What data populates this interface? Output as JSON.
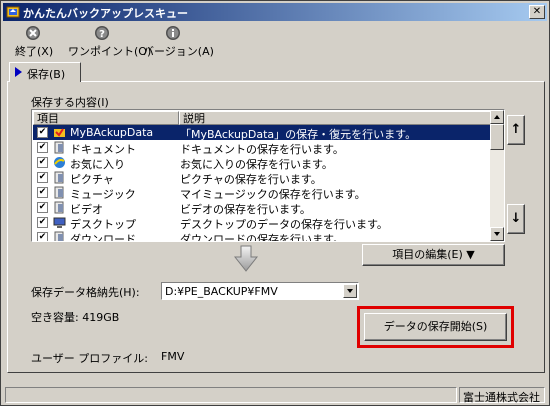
{
  "window": {
    "title": "かんたんバックアップレスキュー",
    "close_glyph": "✕"
  },
  "toolbar": {
    "exit_label": "終了(X)",
    "onepoint_label": "ワンポイント(O)",
    "version_label": "バージョン(A)"
  },
  "tabs": [
    {
      "label": "保存(B)"
    }
  ],
  "backup_list": {
    "label": "保存する内容(I)",
    "columns": [
      "項目",
      "説明"
    ],
    "rows": [
      {
        "name": "MyBAckupData",
        "desc": "「MyBAckupData」の保存・復元を行います。",
        "checked": "✔",
        "icon": "mybackup-icon",
        "selected": true
      },
      {
        "name": "ドキュメント",
        "desc": "ドキュメントの保存を行います。",
        "checked": "✔",
        "icon": "folder-icon"
      },
      {
        "name": "お気に入り",
        "desc": "お気に入りの保存を行います。",
        "checked": "✔",
        "icon": "favorites-icon"
      },
      {
        "name": "ピクチャ",
        "desc": "ピクチャの保存を行います。",
        "checked": "✔",
        "icon": "folder-icon"
      },
      {
        "name": "ミュージック",
        "desc": "マイミュージックの保存を行います。",
        "checked": "✔",
        "icon": "folder-icon"
      },
      {
        "name": "ビデオ",
        "desc": "ビデオの保存を行います。",
        "checked": "✔",
        "icon": "folder-icon"
      },
      {
        "name": "デスクトップ",
        "desc": "デスクトップのデータの保存を行います。",
        "checked": "✔",
        "icon": "desktop-icon"
      },
      {
        "name": "ダウンロード",
        "desc": "ダウンロードの保存を行います。",
        "checked": "✔",
        "icon": "folder-icon"
      }
    ]
  },
  "buttons": {
    "move_up": "↑",
    "move_down": "↓",
    "edit_items": "項目の編集(E) ▼",
    "start_backup": "データの保存開始(S)"
  },
  "destination": {
    "label": "保存データ格納先(H):",
    "value": "D:¥PE_BACKUP¥FMV"
  },
  "free_space": {
    "text": "空き容量: 419GB"
  },
  "profile": {
    "label": "ユーザー プロファイル:",
    "value": "FMV"
  },
  "statusbar": {
    "company": "富士通株式会社"
  },
  "colors": {
    "title_gradient_start": "#0a246a",
    "title_gradient_end": "#a6caf0",
    "selection": "#0a246a",
    "highlight_frame": "#e00000",
    "face": "#d4d0c8"
  }
}
